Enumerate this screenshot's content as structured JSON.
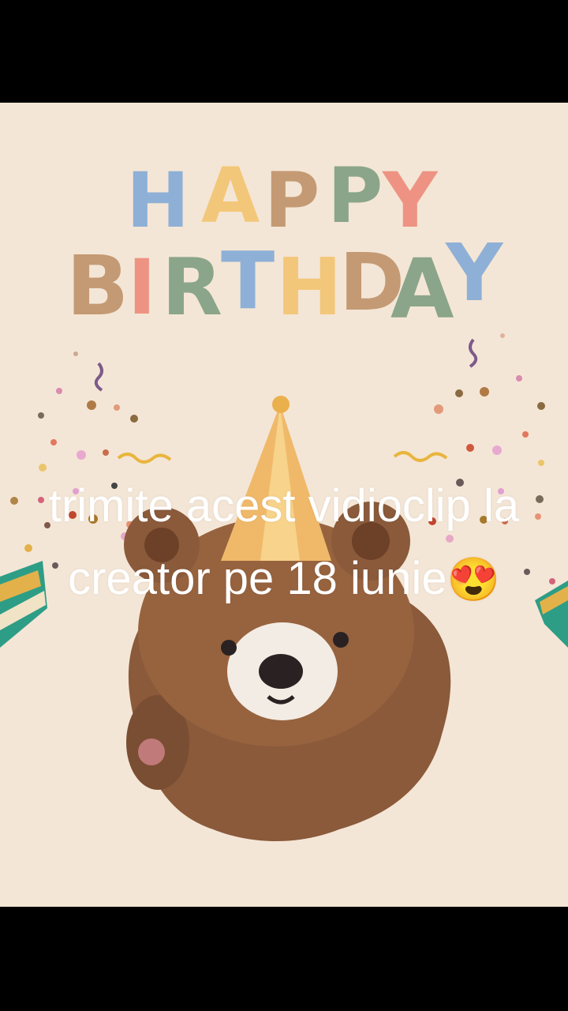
{
  "greeting": {
    "line1": [
      "H",
      "A",
      "P",
      "P",
      "Y"
    ],
    "line2": [
      "B",
      "I",
      "R",
      "T",
      "H",
      "D",
      "A",
      "Y"
    ],
    "colors": {
      "blue": "#8fb0d6",
      "yellow": "#f3c779",
      "brown": "#c49a74",
      "green": "#8ba58a",
      "pink": "#ee9383"
    }
  },
  "caption": {
    "text": "trimite acest vidioclip la creator pe 18 iunie",
    "emoji": "😍"
  },
  "icons": {
    "bear": "bear-illustration",
    "hat": "party-hat-icon",
    "confetti": "confetti-icon",
    "popper": "party-popper-icon"
  }
}
